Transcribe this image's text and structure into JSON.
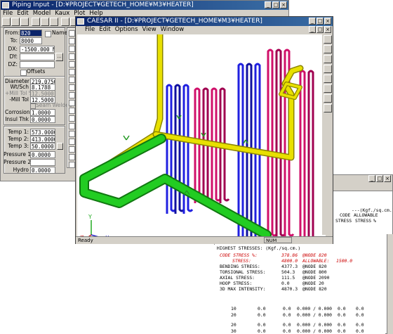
{
  "piping_input": {
    "title": "Piping Input - [D:¥PROJECT¥GETECH_HOME¥M3¥HEATER]",
    "menu": [
      "File",
      "Edit",
      "Model",
      "Kaux",
      "Plot",
      "Help"
    ],
    "from_label": "From:",
    "from_value": "820",
    "to_label": "To:",
    "to_value": "8000",
    "name_label": "Name",
    "dx_label": "DX:",
    "dx_value": "-1500.000 MM",
    "dy_label": "DY:",
    "dy_value": "",
    "dz_label": "DZ:",
    "dz_value": "",
    "offsets_label": "Offsets",
    "diameter_label": "Diameter",
    "diameter_value": "219.0750",
    "wtsch_label": "Wt/Sch",
    "wtsch_value": "8.1788",
    "milltol_plus_label": "+Mill Tol %",
    "milltol_plus_value": "12.5000",
    "milltol_minus_label": "-Mill Tol",
    "milltol_minus_value": "12.5000",
    "seam_label": "Seam Welded",
    "corrosion_label": "Corrosion",
    "corrosion_value": "1.0000",
    "insul_label": "Insul Thk",
    "insul_value": "0.0000",
    "temp1_label": "Temp 1:",
    "temp1_value": "573.0000",
    "temp2_label": "Temp 2:",
    "temp2_value": "413.0000",
    "temp3_label": "Temp 3:",
    "temp3_value": "50.0000",
    "pressure1_label": "Pressure 1:",
    "pressure1_value": "0.0000",
    "pressure2_label": "Pressure 2:",
    "pressure2_value": "",
    "hydro_label": "Hydro",
    "hydro_value": "0.0000",
    "browse_label": "..."
  },
  "caesar": {
    "title": "CAESAR II - [D:¥PROJECT¥GETECH_HOME¥M3¥HEATER]",
    "menu": [
      "File",
      "Edit",
      "Options",
      "View",
      "Window"
    ],
    "status_left": "Ready",
    "status_right": "NUM",
    "axis_y": "Y",
    "axis_x": "X",
    "axis_z": "Z"
  },
  "report": {
    "header_line1": "---(Kgf./sq.cm.)---",
    "header_code": "CODE",
    "header_allowable": "ALLOWABLE",
    "header_stress1": "STRESS",
    "header_stress2": "STRESS",
    "header_pct": "%",
    "highest_title": "HIGHEST STRESSES: (Kgf./sq.cm.)",
    "code_stress_label": "CODE STRESS %:",
    "code_stress_value": "378.86",
    "code_stress_node": "@NODE 820",
    "stress_label": "STRESS:",
    "stress_value": "4800.0",
    "allowable_label": "ALLOWABLE:",
    "allowable_value": "1500.0",
    "rows": [
      {
        "label": "BENDING STRESS:",
        "value": "4377.3",
        "node": "@NODE 820"
      },
      {
        "label": "TORSIONAL STRESS:",
        "value": "504.3",
        "node": "@NODE 800"
      },
      {
        "label": "AXIAL STRESS:",
        "value": "111.5",
        "node": "@NODE 2090"
      },
      {
        "label": "HOOP STRESS:",
        "value": "0.0",
        "node": "@NODE 20"
      },
      {
        "label": "3D MAX INTENSITY:",
        "value": "4870.3",
        "node": "@NODE 820"
      }
    ],
    "table": [
      {
        "node": "10",
        "a": "0.0",
        "b": "0.0",
        "c": "0.000 / 0.000",
        "d": "0.0",
        "e": "0.0"
      },
      {
        "node": "20",
        "a": "0.0",
        "b": "0.0",
        "c": "0.000 / 0.000",
        "d": "0.0",
        "e": "0.0"
      },
      {
        "node": "20",
        "a": "0.0",
        "b": "0.0",
        "c": "0.000 / 0.000",
        "d": "0.0",
        "e": "0.0"
      },
      {
        "node": "30",
        "a": "0.0",
        "b": "0.0",
        "c": "0.000 / 0.000",
        "d": "0.0",
        "e": "0.0"
      }
    ]
  },
  "colors": {
    "red": "#cc0000",
    "pipe_green": "#22cc22",
    "pipe_yellow": "#e8e000"
  }
}
